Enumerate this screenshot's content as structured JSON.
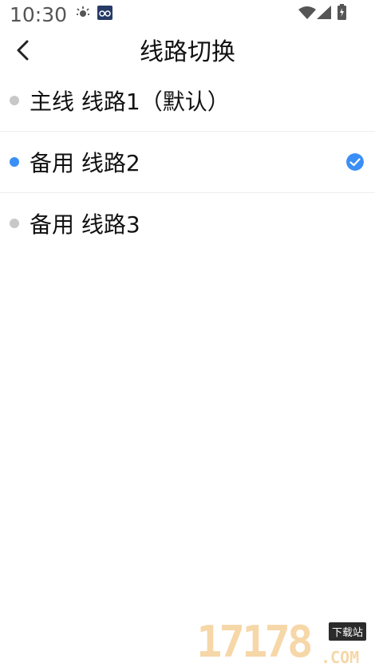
{
  "status_bar": {
    "time": "10:30",
    "icons": [
      "brightness-icon",
      "app-notification-icon",
      "wifi-icon",
      "cellular-signal-icon",
      "battery-icon"
    ]
  },
  "header": {
    "back_icon": "chevron-left-icon",
    "title": "线路切换"
  },
  "routes": [
    {
      "label": "主线 线路1（默认）",
      "selected": false
    },
    {
      "label": "备用 线路2",
      "selected": true
    },
    {
      "label": "备用 线路3",
      "selected": false
    }
  ],
  "colors": {
    "accent": "#3a8ef6",
    "inactive_dot": "#c8c8c8",
    "divider": "#eeeeee"
  },
  "watermark": {
    "number": "17178",
    "badge": "下载站",
    "suffix": ".COM"
  }
}
